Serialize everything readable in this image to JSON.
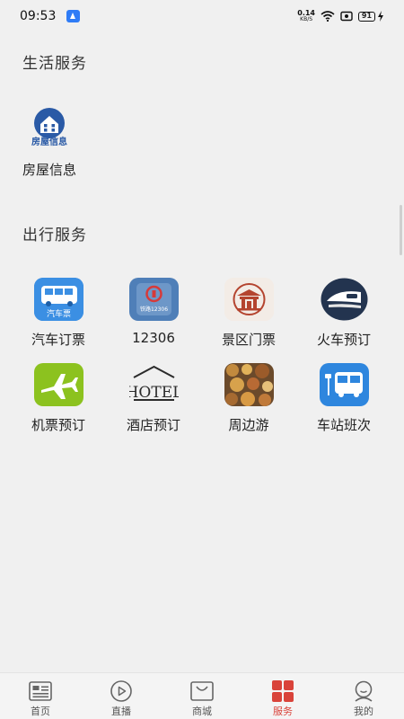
{
  "status_bar": {
    "time": "09:53",
    "net_speed": "0.14",
    "net_unit": "KB/S",
    "battery": "91"
  },
  "sections": {
    "life": {
      "title": "生活服务",
      "items": [
        {
          "label": "房屋信息",
          "icon": "house-info-icon",
          "icon_text": "房屋信息"
        }
      ]
    },
    "travel": {
      "title": "出行服务",
      "items": [
        {
          "label": "汽车订票",
          "icon": "bus-ticket-icon",
          "icon_text": "汽车票",
          "color": "#3a8de0"
        },
        {
          "label": "12306",
          "icon": "railway-12306-icon",
          "icon_text": "铁路12306",
          "color": "#4f7fb8"
        },
        {
          "label": "景区门票",
          "icon": "scenic-gate-icon",
          "color": "#f3ece6"
        },
        {
          "label": "火车预订",
          "icon": "train-icon",
          "color": "#23344f"
        },
        {
          "label": "机票预订",
          "icon": "airplane-icon",
          "color": "#8cc21f"
        },
        {
          "label": "酒店预订",
          "icon": "hotel-icon",
          "icon_text": "HOTEL"
        },
        {
          "label": "周边游",
          "icon": "food-photo-icon"
        },
        {
          "label": "车站班次",
          "icon": "bus-station-icon",
          "color": "#2e86de"
        }
      ]
    }
  },
  "tabbar": {
    "active_color": "#d9433a",
    "tabs": [
      {
        "label": "首页",
        "icon": "home-icon"
      },
      {
        "label": "直播",
        "icon": "play-icon"
      },
      {
        "label": "商城",
        "icon": "shopping-bag-icon"
      },
      {
        "label": "服务",
        "icon": "services-grid-icon",
        "active": true
      },
      {
        "label": "我的",
        "icon": "profile-icon"
      }
    ]
  }
}
